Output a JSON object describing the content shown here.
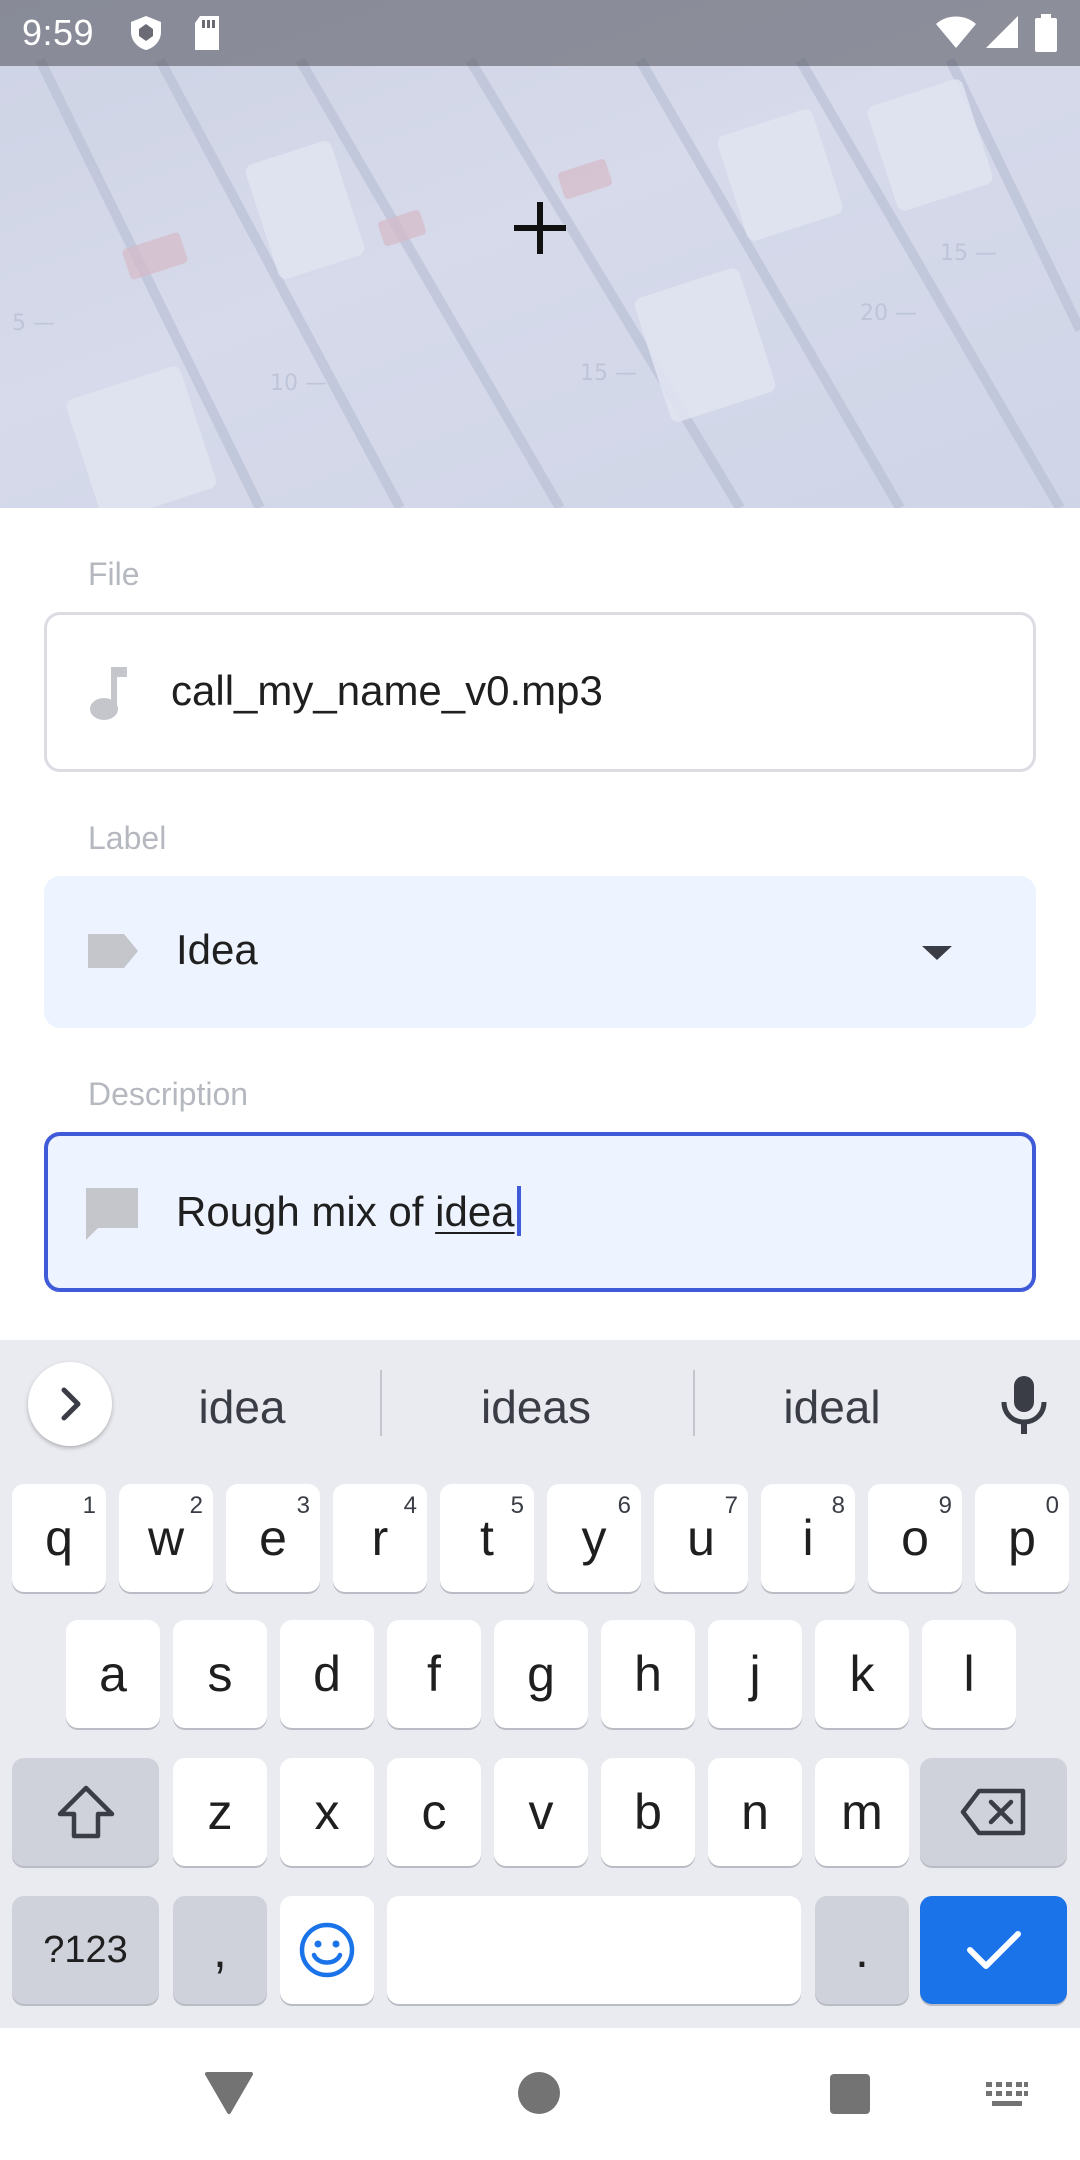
{
  "status_bar": {
    "time": "9:59",
    "icons": [
      "shield-icon",
      "sd-card-icon",
      "wifi-icon",
      "signal-icon",
      "battery-icon"
    ]
  },
  "header": {
    "image": "audio-mixer-photo",
    "add_icon": "plus-icon"
  },
  "form": {
    "file": {
      "label": "File",
      "value": "call_my_name_v0.mp3",
      "icon": "music-note-icon"
    },
    "label_field": {
      "label": "Label",
      "value": "Idea",
      "icon": "label-tag-icon",
      "dropdown_icon": "dropdown-arrow-icon"
    },
    "description": {
      "label": "Description",
      "value_prefix": "Rough mix of ",
      "value_composing": "idea",
      "icon": "comment-icon"
    }
  },
  "keyboard": {
    "suggestions": [
      "idea",
      "ideas",
      "ideal"
    ],
    "row1": [
      {
        "key": "q",
        "hint": "1"
      },
      {
        "key": "w",
        "hint": "2"
      },
      {
        "key": "e",
        "hint": "3"
      },
      {
        "key": "r",
        "hint": "4"
      },
      {
        "key": "t",
        "hint": "5"
      },
      {
        "key": "y",
        "hint": "6"
      },
      {
        "key": "u",
        "hint": "7"
      },
      {
        "key": "i",
        "hint": "8"
      },
      {
        "key": "o",
        "hint": "9"
      },
      {
        "key": "p",
        "hint": "0"
      }
    ],
    "row2": [
      "a",
      "s",
      "d",
      "f",
      "g",
      "h",
      "j",
      "k",
      "l"
    ],
    "row3": [
      "z",
      "x",
      "c",
      "v",
      "b",
      "n",
      "m"
    ],
    "symbols_label": "?123",
    "comma": ",",
    "period": ".",
    "enter_color": "#1a73e8"
  },
  "colors": {
    "focus_border": "#3f5bd8",
    "field_fill": "#eef4ff",
    "label_text": "#b6b8c0"
  }
}
